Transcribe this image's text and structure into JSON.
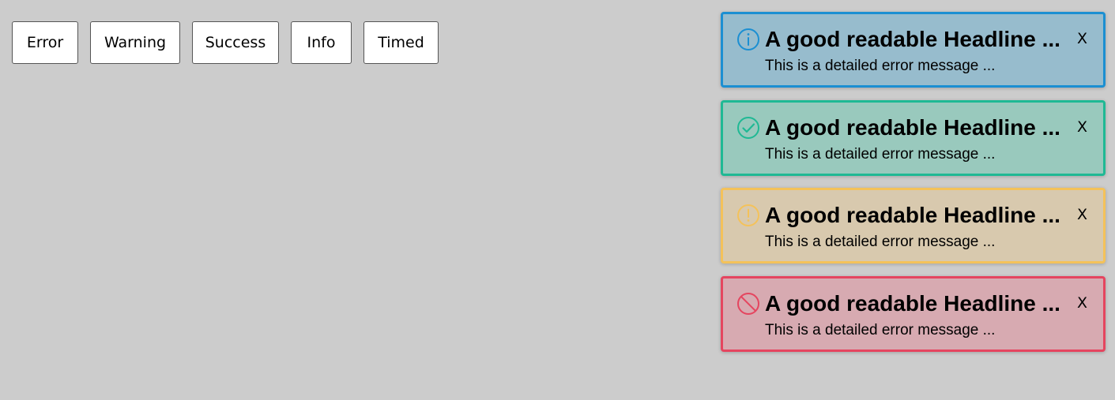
{
  "buttons": {
    "error": "Error",
    "warning": "Warning",
    "success": "Success",
    "info": "Info",
    "timed": "Timed"
  },
  "toasts": [
    {
      "type": "info",
      "icon": "info-circle-icon",
      "title": "A good readable Headline ...",
      "message": "This is a detailed error message ...",
      "close": "X",
      "border_color": "#1b8fd2",
      "bg_color": "#97bccd"
    },
    {
      "type": "success",
      "icon": "check-circle-icon",
      "title": "A good readable Headline ...",
      "message": "This is a detailed error message ...",
      "close": "X",
      "border_color": "#1fb994",
      "bg_color": "#99c9bd"
    },
    {
      "type": "warning",
      "icon": "exclamation-circle-icon",
      "title": "A good readable Headline ...",
      "message": "This is a detailed error message ...",
      "close": "X",
      "border_color": "#f4c25a",
      "bg_color": "#d8c9ae"
    },
    {
      "type": "error",
      "icon": "ban-circle-icon",
      "title": "A good readable Headline ...",
      "message": "This is a detailed error message ...",
      "close": "X",
      "border_color": "#e5455f",
      "bg_color": "#d7aab1"
    }
  ]
}
